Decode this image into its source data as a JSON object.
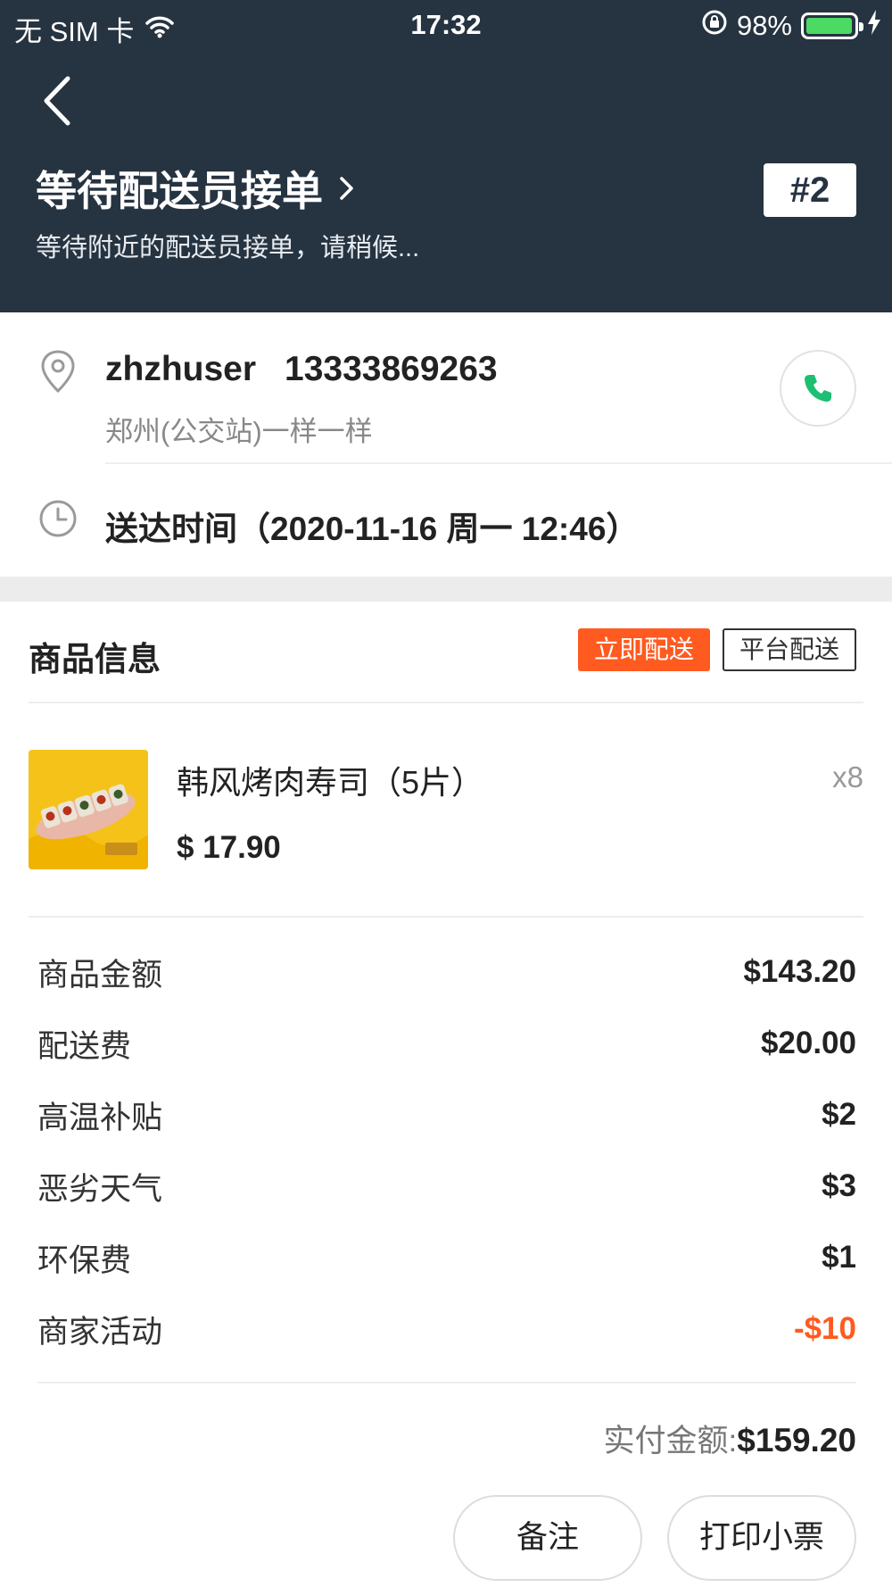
{
  "status_bar": {
    "carrier": "无 SIM 卡",
    "time": "17:32",
    "battery": "98%",
    "battery_level": 0.98
  },
  "header": {
    "status_title": "等待配送员接单",
    "status_subtitle": "等待附近的配送员接单，请稍候...",
    "order_number": "#2"
  },
  "address": {
    "name": "zhzhuser",
    "phone": "13333869263",
    "address": "郑州(公交站)一样一样",
    "delivery_time": "送达时间（2020-11-16 周一 12:46）"
  },
  "goods": {
    "title": "商品信息",
    "tag_fast": "立即配送",
    "tag_platform": "平台配送",
    "product": {
      "name": "韩风烤肉寿司（5片）",
      "qty": "x8",
      "price": "$ 17.90"
    }
  },
  "fees": [
    {
      "label": "商品金额",
      "value": "$143.20",
      "negative": false
    },
    {
      "label": "配送费",
      "value": "$20.00",
      "negative": false
    },
    {
      "label": "高温补贴",
      "value": "$2",
      "negative": false
    },
    {
      "label": "恶劣天气",
      "value": "$3",
      "negative": false
    },
    {
      "label": "环保费",
      "value": "$1",
      "negative": false
    },
    {
      "label": "商家活动",
      "value": "-$10",
      "negative": true
    }
  ],
  "total": {
    "label": "实付金额:",
    "value": "$159.20"
  },
  "actions": {
    "note": "备注",
    "print": "打印小票"
  },
  "colors": {
    "header_bg": "#263341",
    "accent": "#ff5a1f",
    "call_green": "#1dbf73"
  }
}
